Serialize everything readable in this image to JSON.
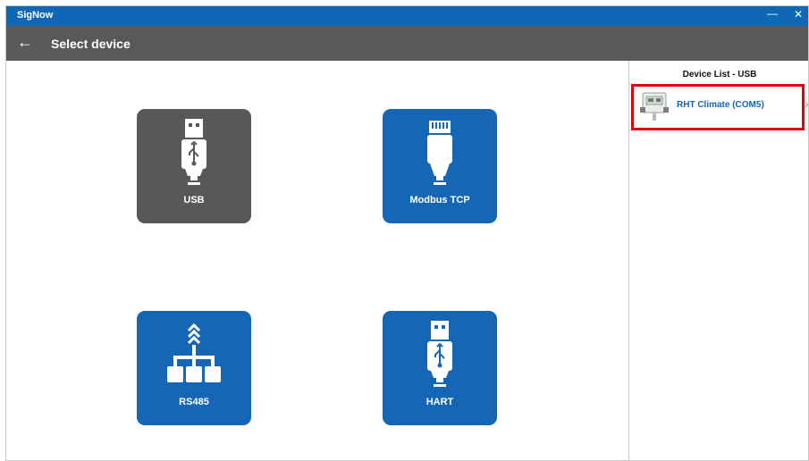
{
  "window": {
    "title": "SigNow",
    "minimize_glyph": "—",
    "close_glyph": "✕"
  },
  "header": {
    "back_glyph": "←",
    "title": "Select device"
  },
  "tiles": [
    {
      "label": "USB",
      "icon": "usb-icon",
      "selected": true
    },
    {
      "label": "Modbus TCP",
      "icon": "ethernet-plug-icon",
      "selected": false
    },
    {
      "label": "RS485",
      "icon": "rs485-network-icon",
      "selected": false
    },
    {
      "label": "HART",
      "icon": "usb-icon",
      "selected": false
    }
  ],
  "device_list": {
    "title": "Device List - USB",
    "items": [
      {
        "name": "RHT Climate (COM5)",
        "icon": "device-thumbnail-icon",
        "highlighted": true
      }
    ],
    "chevron_glyph": "›"
  },
  "colors": {
    "titlebar": "#0f67b5",
    "header": "#595959",
    "tile": "#1566b5",
    "tile_selected": "#585858",
    "highlight": "#e3000b",
    "device_link": "#1c5fb3"
  }
}
